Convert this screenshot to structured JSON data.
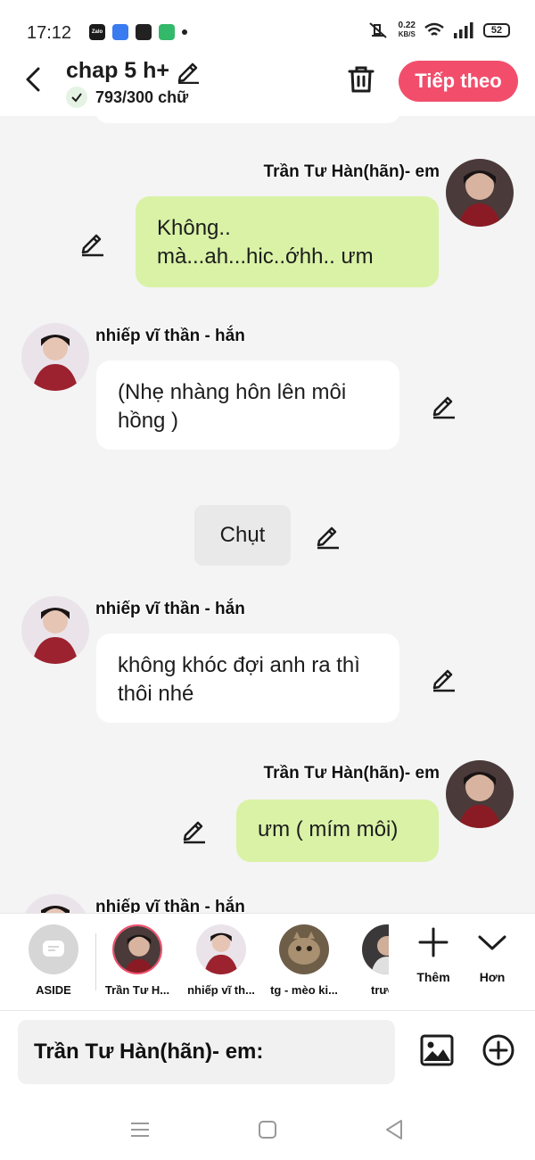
{
  "status_bar": {
    "time": "17:12",
    "speed_value": "0.22",
    "speed_unit": "KB/S",
    "battery": "52",
    "app_icons": [
      "Zalo",
      "Messenger",
      "TikTok",
      "Phone"
    ]
  },
  "header": {
    "title": "chap 5 h+",
    "word_count": "793/300 chữ",
    "next_label": "Tiếp theo"
  },
  "messages": [
    {
      "id": "m1",
      "side": "right",
      "sender": "Trần Tư Hàn(hãn)- em",
      "text": "Không..\nmà...ah...hic..ớhh.. ưm"
    },
    {
      "id": "m2",
      "side": "left",
      "sender": "nhiếp vĩ thần - hắn",
      "text": "(Nhẹ nhàng hôn lên môi hồng )"
    },
    {
      "id": "m3",
      "side": "center",
      "text": "Chụt"
    },
    {
      "id": "m4",
      "side": "left",
      "sender": "nhiếp vĩ thần - hắn",
      "text": "không khóc đợi anh ra thì thôi nhé"
    },
    {
      "id": "m5",
      "side": "right",
      "sender": "Trần Tư Hàn(hãn)- em",
      "text": "ưm ( mím môi)"
    },
    {
      "id": "m6",
      "side": "left",
      "sender": "nhiếp vĩ thần - hắn",
      "text": ""
    }
  ],
  "characters": [
    {
      "label": "ASIDE"
    },
    {
      "label": "Trần Tư H..."
    },
    {
      "label": "nhiếp vĩ th..."
    },
    {
      "label": "tg - mèo ki..."
    },
    {
      "label": "trươn"
    }
  ],
  "tools": {
    "add_label": "Thêm",
    "more_label": "Hơn"
  },
  "composer": {
    "placeholder": "Trần Tư Hàn(hãn)- em:"
  },
  "colors": {
    "accent": "#f24e6c",
    "right_bubble": "#d9f2a6",
    "left_bubble": "#ffffff",
    "background": "#f4f4f4"
  }
}
